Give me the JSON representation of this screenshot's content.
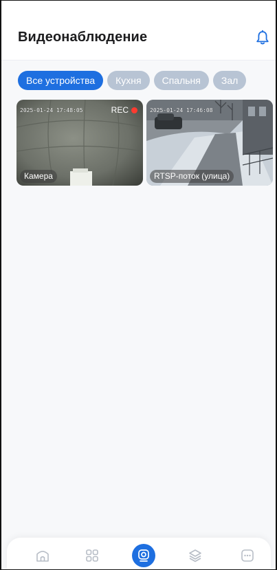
{
  "header": {
    "title": "Видеонаблюдение",
    "notification_icon": "bell-icon"
  },
  "filters": {
    "chips": [
      {
        "label": "Все устройства",
        "active": true
      },
      {
        "label": "Кухня",
        "active": false
      },
      {
        "label": "Спальня",
        "active": false
      },
      {
        "label": "Зал",
        "active": false
      }
    ]
  },
  "cameras": [
    {
      "name": "Камера",
      "timestamp": "2025-01-24 17:48:05",
      "recording_label": "REC",
      "recording": true
    },
    {
      "name": "RTSP-поток (улица)",
      "timestamp": "2025-01-24 17:46:08",
      "recording": false
    }
  ],
  "bottom_nav": {
    "items": [
      {
        "icon": "home-icon",
        "active": false
      },
      {
        "icon": "devices-grid-icon",
        "active": false
      },
      {
        "icon": "camera-icon",
        "active": true
      },
      {
        "icon": "layers-icon",
        "active": false
      },
      {
        "icon": "more-icon",
        "active": false
      }
    ]
  },
  "colors": {
    "accent": "#1e6fe0",
    "chip_inactive": "#b8c4d4",
    "rec_dot": "#ff3b30"
  }
}
